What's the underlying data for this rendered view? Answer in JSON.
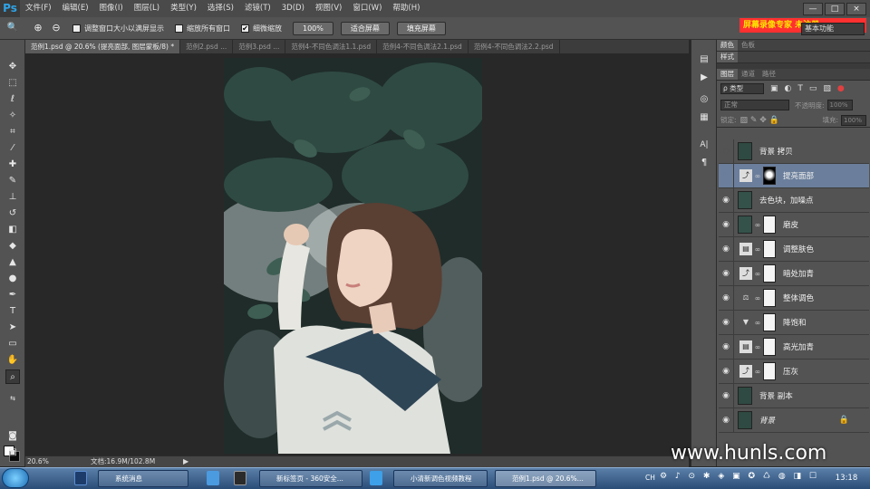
{
  "app": {
    "logo": "Ps"
  },
  "menus": [
    "文件(F)",
    "编辑(E)",
    "图像(I)",
    "图层(L)",
    "类型(Y)",
    "选择(S)",
    "滤镜(T)",
    "3D(D)",
    "视图(V)",
    "窗口(W)",
    "帮助(H)"
  ],
  "window_controls": [
    "—",
    "□",
    "×"
  ],
  "options_bar": {
    "tool_icon": "zoom-icon",
    "resize_label": "调整窗口大小以满屏显示",
    "zoom_all_label": "缩放所有窗口",
    "scrubby_label": "细微缩放",
    "scrubby_checked": true,
    "btn_100": "100%",
    "btn_fit": "适合屏幕",
    "btn_fill": "填充屏幕",
    "workspace": "基本功能",
    "watermark": "屏幕录像专家 未注册"
  },
  "tabs": [
    {
      "label": "范例1.psd @ 20.6% (提亮面部, 图层蒙板/8) *",
      "active": true
    },
    {
      "label": "范例2.psd ...",
      "active": false
    },
    {
      "label": "范例3.psd ...",
      "active": false
    },
    {
      "label": "范例4-不同色调法1.1.psd",
      "active": false
    },
    {
      "label": "范例4-不同色调法2.1.psd",
      "active": false
    },
    {
      "label": "范例4-不同色调法2.2.psd",
      "active": false
    }
  ],
  "status": {
    "zoom": "20.6%",
    "doc": "文档:16.9M/102.8M"
  },
  "panels": {
    "top_tabs": [
      "颜色",
      "色板"
    ],
    "style_tab": "样式",
    "layer_tabs": [
      "图层",
      "通道",
      "路径"
    ],
    "filter_kind": "ρ 类型",
    "blend_mode": "正常",
    "opacity_label": "不透明度:",
    "opacity_value": "100%",
    "lock_label": "锁定:",
    "fill_label": "填充:",
    "fill_value": "100%"
  },
  "layers": [
    {
      "name": "背景 拷贝",
      "visible": false,
      "kind": "image",
      "selected": false
    },
    {
      "name": "提亮面部",
      "visible": true,
      "kind": "curves",
      "selected": true
    },
    {
      "name": "去色块，加噪点",
      "visible": true,
      "kind": "image",
      "selected": false
    },
    {
      "name": "磨皮",
      "visible": true,
      "kind": "image-mask",
      "selected": false
    },
    {
      "name": "调整肤色",
      "visible": true,
      "kind": "levels",
      "selected": false
    },
    {
      "name": "暗处加青",
      "visible": true,
      "kind": "curves",
      "selected": false
    },
    {
      "name": "整体调色",
      "visible": true,
      "kind": "balance",
      "selected": false
    },
    {
      "name": "降饱和",
      "visible": true,
      "kind": "vibrance",
      "selected": false
    },
    {
      "name": "高光加青",
      "visible": true,
      "kind": "levels",
      "selected": false
    },
    {
      "name": "压灰",
      "visible": true,
      "kind": "curves",
      "selected": false
    },
    {
      "name": "背景 副本",
      "visible": true,
      "kind": "image",
      "selected": false
    },
    {
      "name": "背景",
      "visible": true,
      "kind": "image-locked",
      "selected": false
    }
  ],
  "taskbar": {
    "items": [
      "系统消息",
      "新标签页 - 360安全...",
      "小清新调色视频教程",
      "范例1.psd @ 20.6%..."
    ],
    "lang": "CH",
    "clock": "13:18"
  },
  "watermark": "www.hunls.com",
  "colors": {
    "accent": "#2fa3e6",
    "selected_layer": "#6b7f9c",
    "panel_bg": "#535353"
  }
}
